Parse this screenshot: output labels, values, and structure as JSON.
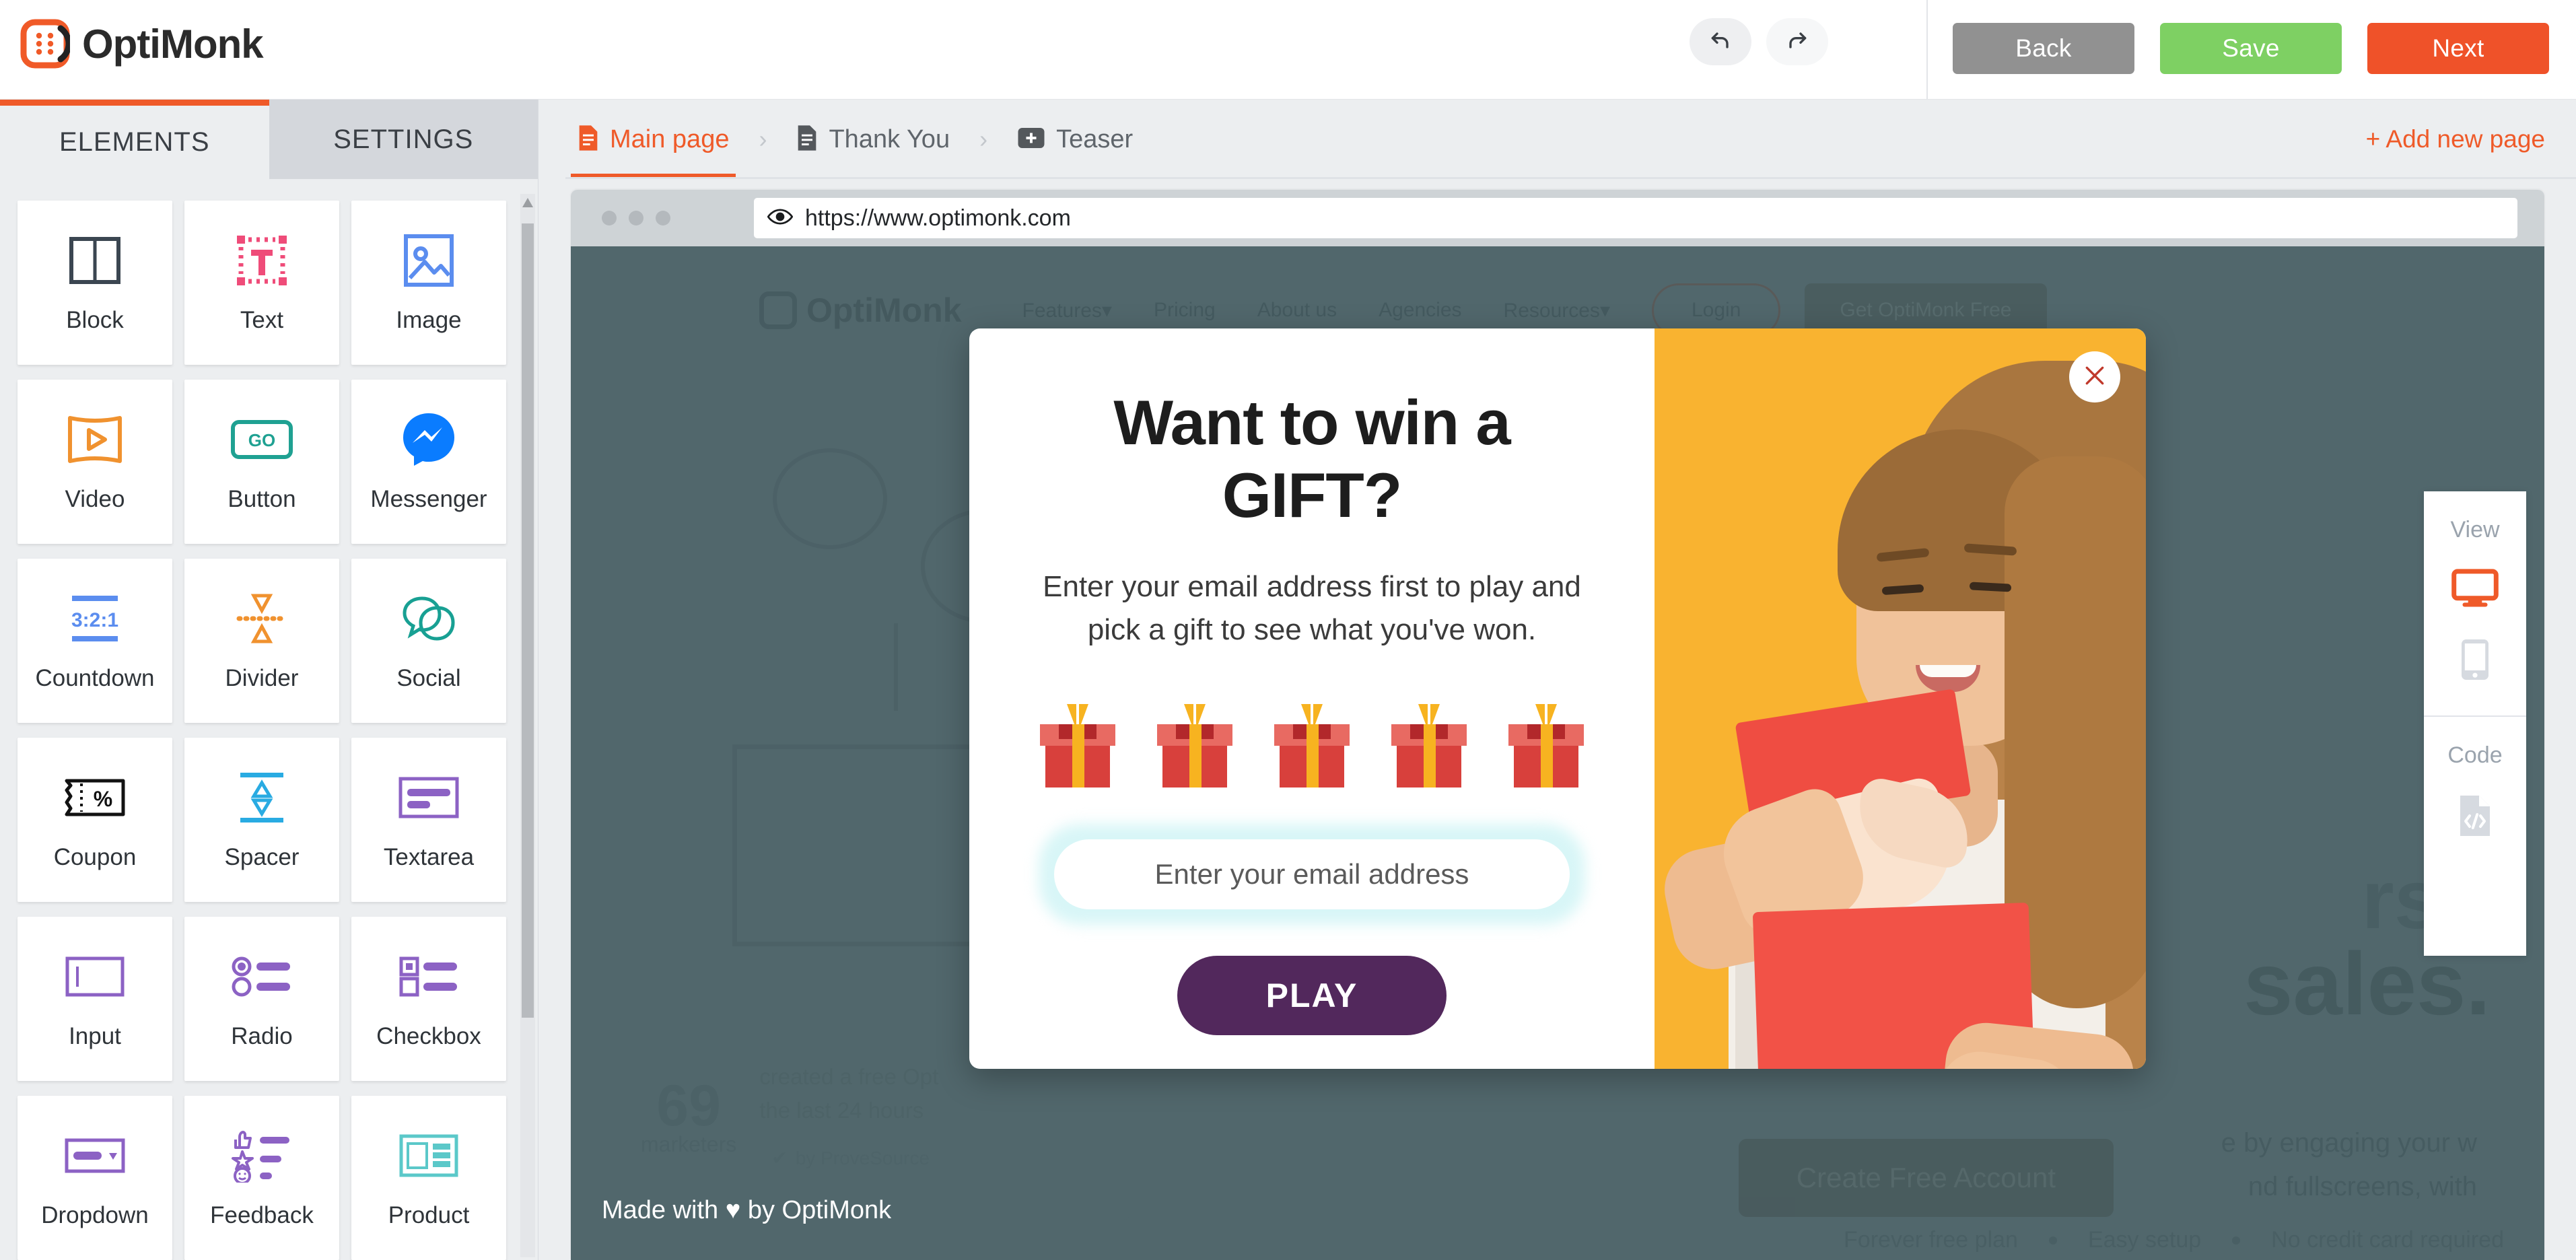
{
  "brand": {
    "name": "OptiMonk",
    "accent_orange": "#ef5a29",
    "save_green": "#7ed063",
    "back_gray": "#919191"
  },
  "topbar": {
    "logo_text": "OptiMonk",
    "undo_icon": "undo-icon",
    "redo_icon": "redo-icon",
    "back_label": "Back",
    "save_label": "Save",
    "next_label": "Next"
  },
  "left_panel": {
    "tabs": [
      {
        "label": "ELEMENTS",
        "active": true
      },
      {
        "label": "SETTINGS",
        "active": false
      }
    ],
    "elements": [
      {
        "label": "Block",
        "icon": "block-icon"
      },
      {
        "label": "Text",
        "icon": "text-icon"
      },
      {
        "label": "Image",
        "icon": "image-icon"
      },
      {
        "label": "Video",
        "icon": "video-icon"
      },
      {
        "label": "Button",
        "icon": "button-icon"
      },
      {
        "label": "Messenger",
        "icon": "messenger-icon"
      },
      {
        "label": "Countdown",
        "icon": "countdown-icon"
      },
      {
        "label": "Divider",
        "icon": "divider-icon"
      },
      {
        "label": "Social",
        "icon": "social-icon"
      },
      {
        "label": "Coupon",
        "icon": "coupon-icon"
      },
      {
        "label": "Spacer",
        "icon": "spacer-icon"
      },
      {
        "label": "Textarea",
        "icon": "textarea-icon"
      },
      {
        "label": "Input",
        "icon": "input-icon"
      },
      {
        "label": "Radio",
        "icon": "radio-icon"
      },
      {
        "label": "Checkbox",
        "icon": "checkbox-icon"
      },
      {
        "label": "Dropdown",
        "icon": "dropdown-icon"
      },
      {
        "label": "Feedback",
        "icon": "feedback-icon"
      },
      {
        "label": "Product",
        "icon": "product-icon"
      }
    ],
    "countdown_text": "3:2:1",
    "button_icon_text": "GO"
  },
  "page_bar": {
    "pages": [
      {
        "label": "Main page",
        "icon": "document-icon",
        "active": true
      },
      {
        "label": "Thank You",
        "icon": "document-icon",
        "active": false
      },
      {
        "label": "Teaser",
        "icon": "plus-square-icon",
        "active": false
      }
    ],
    "separator": "›",
    "add_new_page": "+ Add new page"
  },
  "browser": {
    "url": "https://www.optimonk.com",
    "eye_icon": "eye-icon"
  },
  "site": {
    "logo_text": "OptiMonk",
    "nav": [
      "Features",
      "Pricing",
      "About us",
      "Agencies",
      "Resources"
    ],
    "features_caret": "▾",
    "resources_caret": "▾",
    "login_label": "Login",
    "cta_label": "Get OptiMonk Free",
    "hero_line1": "rs.",
    "hero_line2": "sales.",
    "sub_line1": "e by engaging your w",
    "sub_line2": "nd fullscreens, with",
    "cta2_label": "Create Free Account",
    "badges": [
      "Forever free plan",
      "Easy setup",
      "No credit card required"
    ],
    "made_with": "Made with ♥ by OptiMonk",
    "prove": {
      "number": "69",
      "unit": "marketers",
      "line1": "created a free Opt",
      "line2": "the last 24 hours",
      "badge": "by ProveSource"
    }
  },
  "popup": {
    "title": "Want to win a GIFT?",
    "subtitle": "Enter your email address first to play and pick a gift to see what you've won.",
    "gift_count": 5,
    "email_placeholder": "Enter your email address",
    "email_value": "",
    "play_label": "PLAY",
    "close_icon": "close-icon",
    "bg_color": "#f9b330",
    "play_color": "#52285c"
  },
  "view_panel": {
    "view_label": "View",
    "code_label": "Code",
    "desktop_icon": "desktop-icon",
    "mobile_icon": "mobile-icon",
    "code_icon": "code-file-icon",
    "active_device": "desktop"
  }
}
